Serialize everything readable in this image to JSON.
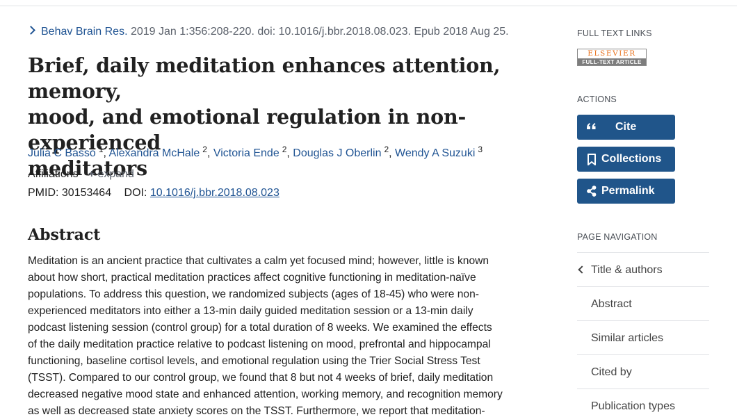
{
  "citation": {
    "journal": "Behav Brain Res.",
    "details": "2019 Jan 1:356:208-220. doi: 10.1016/j.bbr.2018.08.023. Epub 2018 Aug 25."
  },
  "article": {
    "title_lines": [
      "Brief, daily meditation enhances attention, memory,",
      "mood, and emotional regulation in non-experienced",
      "meditators"
    ],
    "authors": [
      {
        "name": "Julia C Basso",
        "aff": "1"
      },
      {
        "name": "Alexandra McHale",
        "aff": "2"
      },
      {
        "name": "Victoria Ende",
        "aff": "2"
      },
      {
        "name": "Douglas J Oberlin",
        "aff": "2"
      },
      {
        "name": "Wendy A Suzuki",
        "aff": "3"
      }
    ],
    "affiliations_label": "Affiliations",
    "expand_label": "expand",
    "pmid_label": "PMID:",
    "pmid": "30153464",
    "doi_label": "DOI:",
    "doi": "10.1016/j.bbr.2018.08.023"
  },
  "abstract": {
    "heading": "Abstract",
    "lines": [
      "Meditation is an ancient practice that cultivates a calm yet focused mind; however, little is known",
      "about how short, practical meditation practices affect cognitive functioning in meditation-naïve",
      "populations. To address this question, we randomized subjects (ages of 18-45) who were non-",
      "experienced meditators into either a 13-min daily guided meditation session or a 13-min daily",
      "podcast listening session (control group) for a total duration of 8 weeks. We examined the effects",
      "of the daily meditation practice relative to podcast listening on mood, prefrontal and hippocampal",
      "functioning, baseline cortisol levels, and emotional regulation using the Trier Social Stress Test",
      "(TSST). Compared to our control group, we found that 8 but not 4 weeks of brief, daily meditation",
      "decreased negative mood state and enhanced attention, working memory, and recognition memory",
      "as well as decreased state anxiety scores on the TSST. Furthermore, we report that meditation-"
    ]
  },
  "sidebar": {
    "full_text_heading": "FULL TEXT LINKS",
    "elsevier_top": "ELSEVIER",
    "elsevier_bottom": "FULL-TEXT ARTICLE",
    "actions_heading": "ACTIONS",
    "cite_label": "Cite",
    "collections_label": "Collections",
    "permalink_label": "Permalink",
    "page_nav_heading": "PAGE NAVIGATION",
    "nav_items": [
      "Title & authors",
      "Abstract",
      "Similar articles",
      "Cited by",
      "Publication types"
    ]
  },
  "colors": {
    "link": "#205493",
    "button": "#20558a",
    "elsevier_orange": "#e9711c"
  },
  "icons": [
    "chevron-right-icon",
    "plus-icon",
    "quote-icon",
    "bookmark-icon",
    "share-icon",
    "chevron-left-icon"
  ]
}
